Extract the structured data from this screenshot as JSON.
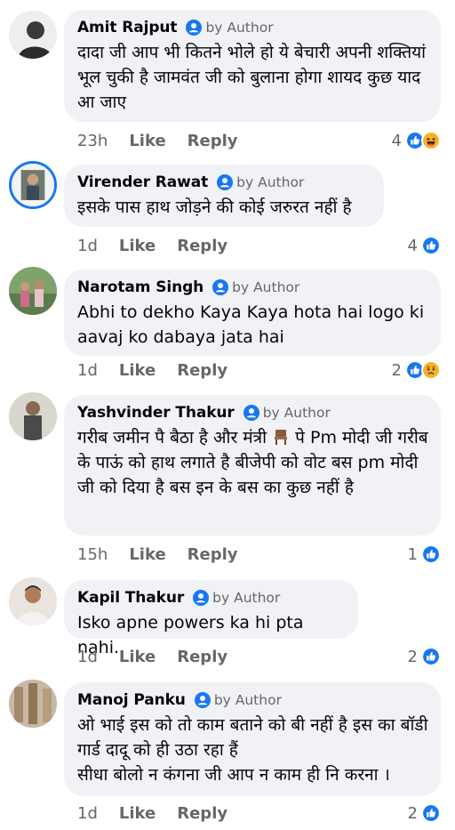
{
  "colors": {
    "bubble": "#f0f2f5",
    "meta_text": "#65676b",
    "like_blue": "#1877f2",
    "reaction_yellow": "#f7b125"
  },
  "comments": [
    {
      "name": "Amit Rajput",
      "badge": "by Author",
      "text": "दादा जी आप भी कितने भोले हो ये बेचारी अपनी शक्तियां भूल चुकी है जामवंत जी को बुलाना होगा शायद कुछ याद आ जाए",
      "time": "23h",
      "like": "Like",
      "reply": "Reply",
      "reaction_count": "4",
      "reactions": [
        "like-icon",
        "haha-icon"
      ]
    },
    {
      "name": "Virender Rawat",
      "badge": "by Author",
      "text": "इसके पास हाथ जोड़ने की कोई जरुरत नहीं है",
      "time": "1d",
      "like": "Like",
      "reply": "Reply",
      "reaction_count": "4",
      "reactions": [
        "like-icon"
      ]
    },
    {
      "name": "Narotam Singh",
      "badge": "by Author",
      "text": "Abhi to dekho Kaya Kaya hota hai logo ki aavaj ko dabaya jata hai",
      "time": "1d",
      "like": "Like",
      "reply": "Reply",
      "reaction_count": "2",
      "reactions": [
        "like-icon",
        "sad-icon"
      ]
    },
    {
      "name": "Yashvinder Thakur",
      "badge": "by Author",
      "text_before": "गरीब जमीन पै बैठा है और मंत्री ",
      "emoji": "chair-icon",
      "text_after": " पे Pm मोदी जी गरीब के पाऊं को हाथ लगाते है बीजेपी को वोट बस pm  मोदी जी को दिया है बस इन के बस का कुछ नहीं है",
      "time": "15h",
      "like": "Like",
      "reply": "Reply",
      "reaction_count": "1",
      "reactions": [
        "like-icon"
      ]
    },
    {
      "name": "Kapil Thakur",
      "badge": "by Author",
      "text": "Isko apne powers ka hi pta nahi.",
      "time": "1d",
      "like": "Like",
      "reply": "Reply",
      "reaction_count": "2",
      "reactions": [
        "like-icon"
      ]
    },
    {
      "name": "Manoj Panku",
      "badge": "by Author",
      "text": "ओ भाई इस को तो काम बताने को बी नहीं है इस का बॉडी गार्ड दादू को ही उठा रहा हैं\nसीधा बोलो न कंगना जी आप न काम ही नि करना ।",
      "time": "1d",
      "like": "Like",
      "reply": "Reply",
      "reaction_count": "2",
      "reactions": [
        "like-icon"
      ]
    }
  ]
}
